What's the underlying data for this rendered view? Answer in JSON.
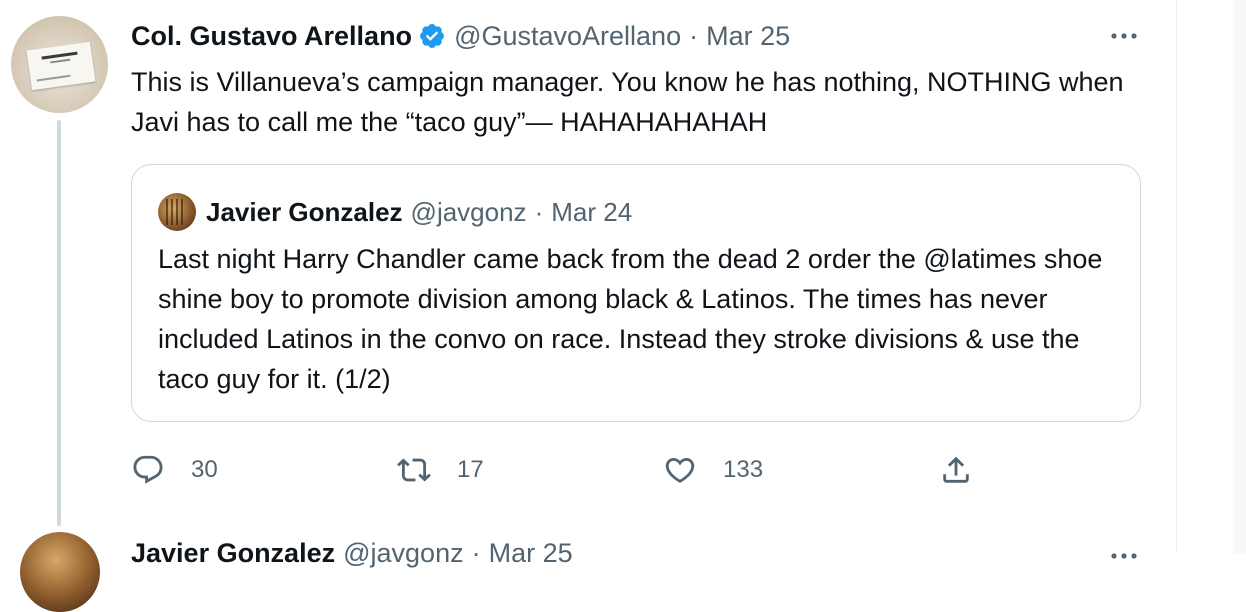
{
  "tweet": {
    "display_name": "Col. Gustavo Arellano",
    "handle": "@GustavoArellano",
    "separator": "·",
    "date": "Mar 25",
    "text": "This is Villanueva’s campaign manager. You know he has nothing, NOTHING when Javi has to call me the “taco guy”— HAHAHAHAHAH",
    "verified_icon": "verified-badge-icon",
    "more_icon": "more-options-icon"
  },
  "quote": {
    "display_name": "Javier Gonzalez",
    "handle": "@javgonz",
    "separator": "·",
    "date": "Mar 24",
    "text": "Last night Harry Chandler came back from the dead 2 order the @latimes shoe shine boy to promote division among black & Latinos. The times has never included Latinos in the convo on race.  Instead they stroke divisions & use the taco guy for it.  (1/2)"
  },
  "actions": {
    "reply_count": "30",
    "retweet_count": "17",
    "like_count": "133",
    "icons": [
      "reply-icon",
      "retweet-icon",
      "like-icon",
      "share-icon"
    ]
  },
  "next_tweet": {
    "display_name": "Javier Gonzalez",
    "handle": "@javgonz",
    "separator": "·",
    "date": "Mar 25"
  },
  "colors": {
    "text_primary": "#0f1419",
    "text_secondary": "#536471",
    "verified_blue": "#1d9bf0",
    "border": "#cfd9de"
  }
}
